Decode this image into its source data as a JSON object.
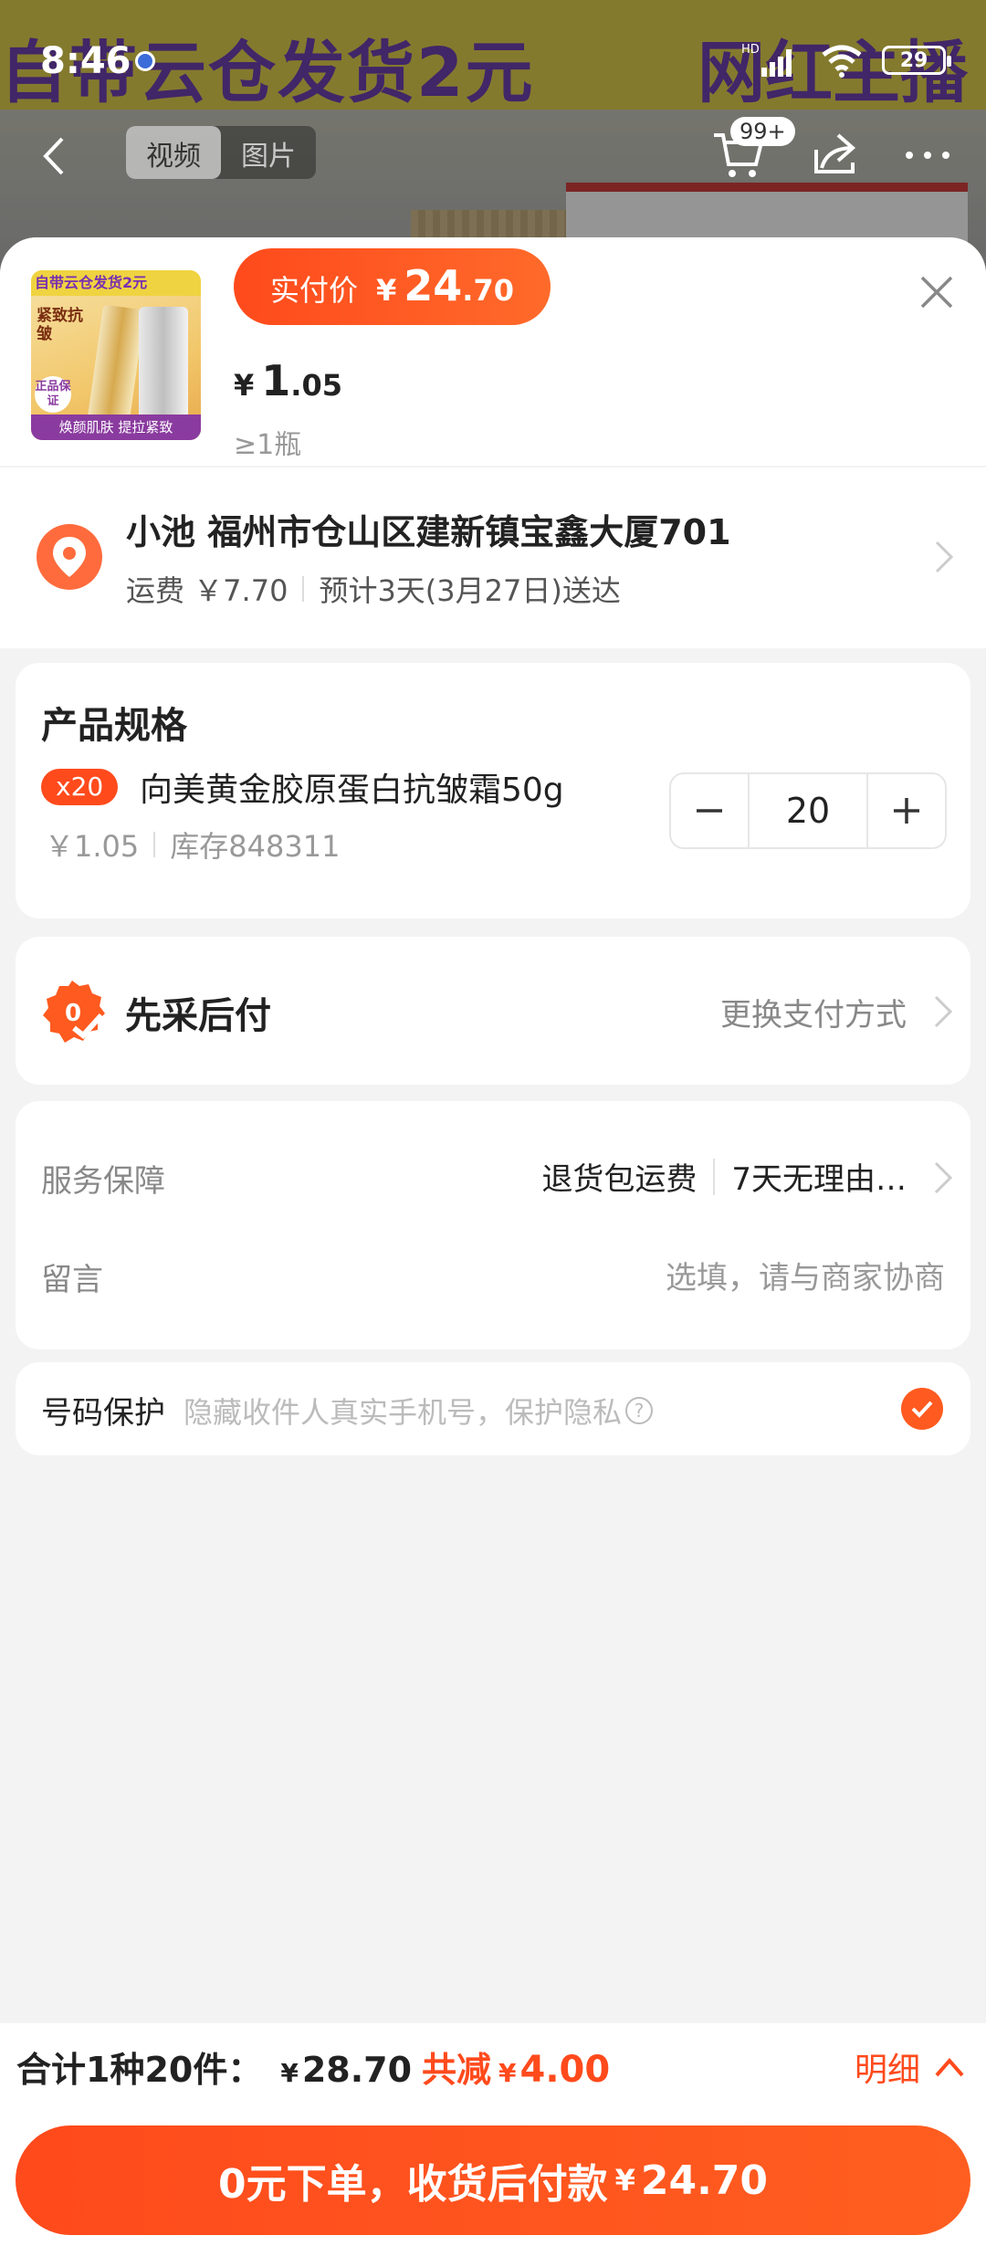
{
  "status_bar": {
    "time": "8:46",
    "network": "HD",
    "battery": "29"
  },
  "background": {
    "banner_left": "自带云仓发货2元",
    "banner_right": "网红主播",
    "media_tabs": [
      "视频",
      "图片"
    ],
    "cart_badge": "99+"
  },
  "product": {
    "thumb_banner": "自带云仓发货2元",
    "thumb_label": "紧致抗皱",
    "thumb_footer": "焕颜肌肤 提拉紧致",
    "thumb_seal": "正品保证",
    "actual_price_label": "实付价",
    "actual_price_symbol": "¥",
    "actual_price_int": "24",
    "actual_price_dec": ".70",
    "unit_price_symbol": "¥",
    "unit_price_int": "1",
    "unit_price_dec": ".05",
    "min_qty": "≥1瓶"
  },
  "address": {
    "line": "小池 福州市仓山区建新镇宝鑫大厦701",
    "shipping_fee": "运费 ￥7.70",
    "delivery": "预计3天(3月27日)送达"
  },
  "spec": {
    "title": "产品规格",
    "qty_tag": "x20",
    "name": "向美黄金胶原蛋白抗皱霜50g",
    "price": "￥1.05",
    "stock": "库存848311",
    "quantity": "20"
  },
  "payment": {
    "title": "先采后付",
    "change_label": "更换支付方式"
  },
  "service": {
    "label": "服务保障",
    "tags": [
      "退货包运费",
      "7天无理由…"
    ],
    "message_label": "留言",
    "message_placeholder": "选填，请与商家协商"
  },
  "privacy": {
    "label": "号码保护",
    "desc": "隐藏收件人真实手机号，保护隐私",
    "help_glyph": "?",
    "checked": true
  },
  "summary": {
    "total_label": "合计1种20件：",
    "total_symbol": "¥",
    "total_amount": "28.70",
    "reduce_label": "共减",
    "reduce_symbol": "¥",
    "reduce_amount": "4.00",
    "detail_label": "明细"
  },
  "cta": {
    "label": "0元下单，收货后付款",
    "symbol": "¥",
    "amount": "24.70"
  },
  "colors": {
    "accent": "#ff4a1c",
    "accent_light": "#ff6b3d",
    "background": "#f3f3f3"
  }
}
